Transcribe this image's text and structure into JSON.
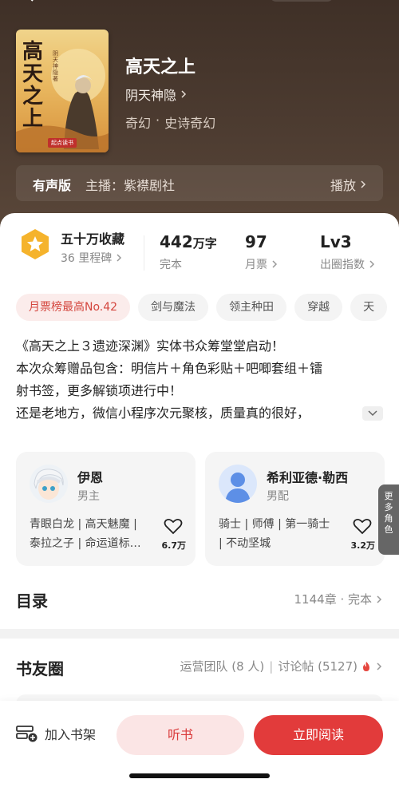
{
  "cover": {
    "title": "高天之上",
    "subtitle": "阴天神隐著",
    "badge": "起点读书"
  },
  "book": {
    "title": "高天之上",
    "author": "阴天神隐",
    "genres": [
      "奇幻",
      "·",
      "史诗奇幻"
    ]
  },
  "audio": {
    "label": "有声版",
    "host": "主播：紫襟剧社",
    "play": "播放"
  },
  "collection": {
    "title": "五十万收藏",
    "subtitle": "36 里程碑"
  },
  "stats": [
    {
      "value": "442",
      "unit": "万字",
      "label": "完本"
    },
    {
      "value": "97",
      "unit": "",
      "label": "月票"
    },
    {
      "value": "Lv3",
      "unit": "",
      "label": "出圈指数"
    }
  ],
  "tags": [
    "月票榜最高No.42",
    "剑与魔法",
    "领主种田",
    "穿越",
    "天"
  ],
  "description": [
    "《高天之上３遗迹深渊》实体书众筹堂堂启动！",
    "本次众筹赠品包含：明信片＋角色彩贴＋吧唧套组＋镭",
    "射书签，更多解锁项进行中！",
    "还是老地方，微信小程序次元聚核，质量真的很好，"
  ],
  "characters": [
    {
      "name": "伊恩",
      "role": "男主",
      "tags": [
        "青眼白龙 | 高天魅魔 |",
        "泰拉之子 | 命运道标…"
      ],
      "likes": "6.7万"
    },
    {
      "name": "希利亚德·勒西",
      "role": "男配",
      "tags": [
        "骑士 | 师傅 | 第一骑士",
        "| 不动坚城"
      ],
      "likes": "3.2万"
    }
  ],
  "more_roles": [
    "更",
    "多",
    "角",
    "色"
  ],
  "toc": {
    "title": "目录",
    "info": "1144章 · 完本"
  },
  "forum": {
    "title": "书友圈",
    "team": "运营团队 (8 人)",
    "sep": "|",
    "posts": "讨论帖 (5127)"
  },
  "bottom": {
    "shelf": "加入书架",
    "listen": "听书",
    "read": "立即阅读"
  },
  "colors": {
    "accent": "#e23b3b",
    "hero_bg": "#4d3c31",
    "badge": "#f5b32c"
  }
}
